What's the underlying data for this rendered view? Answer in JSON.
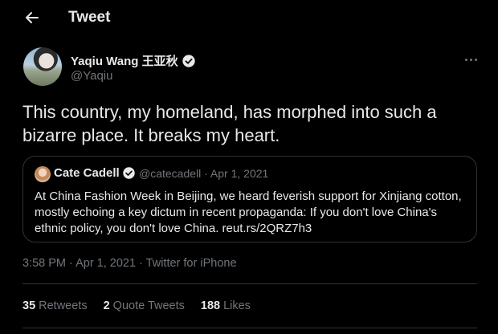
{
  "header": {
    "title": "Tweet"
  },
  "tweet": {
    "author": {
      "name": "Yaqiu Wang 王亚秋",
      "handle": "@Yaqiu",
      "verified": true
    },
    "text": "This country, my homeland, has morphed into such a bizarre place. It breaks my heart.",
    "quoted": {
      "name": "Cate Cadell",
      "handle": "@catecadell",
      "date": "· Apr 1, 2021",
      "text": "At China Fashion Week in Beijing, we heard feverish support for Xinjiang cotton, mostly echoing a key dictum in recent propaganda: If you don't love China's ethnic policy, you don't love China. reut.rs/2QRZ7h3"
    },
    "timestamp": "3:58 PM · Apr 1, 2021 · Twitter for iPhone",
    "stats": {
      "retweets_count": "35",
      "retweets_label": "Retweets",
      "quotes_count": "2",
      "quotes_label": "Quote Tweets",
      "likes_count": "188",
      "likes_label": "Likes"
    }
  },
  "colors": {
    "background": "#000000",
    "text": "#e7e9ea",
    "secondary": "#71767b",
    "border": "#2f3336"
  },
  "icons": {
    "back": "back-arrow-icon",
    "more": "more-icon",
    "verified": "verified-badge-icon"
  }
}
